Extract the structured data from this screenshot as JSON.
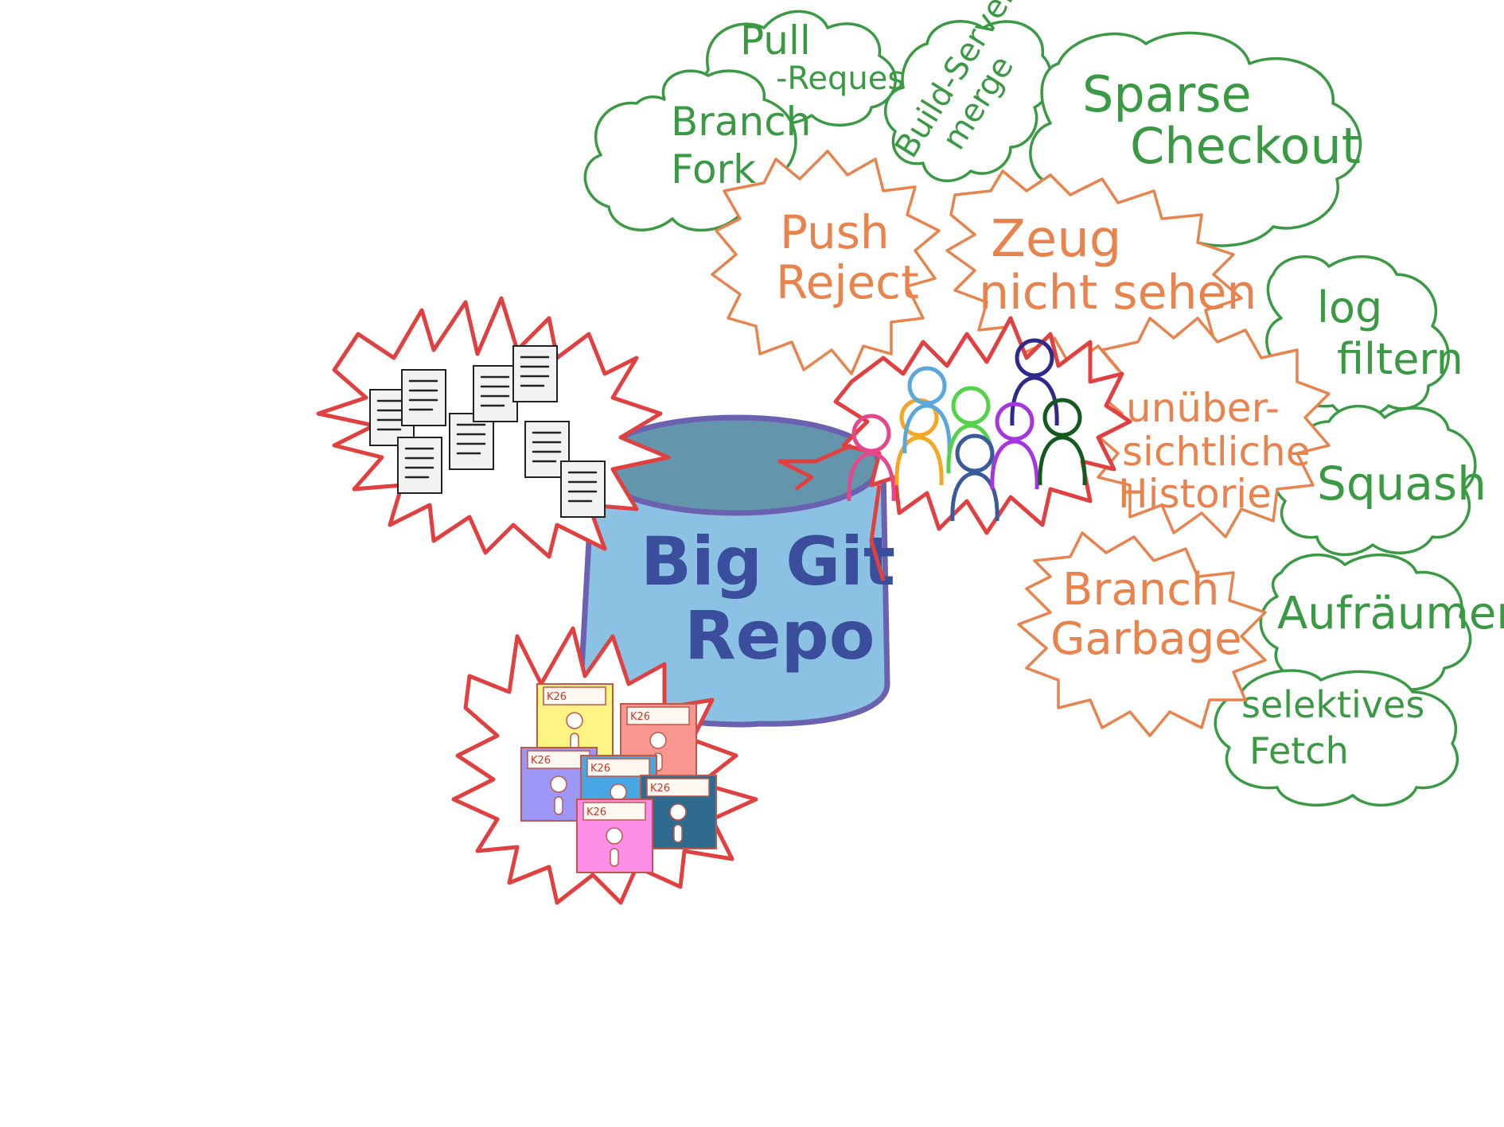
{
  "repo": {
    "line1": "Big Git",
    "line2": "Repo"
  },
  "colors": {
    "repo_fill": "#8bc1e3",
    "repo_top": "#6396ad",
    "repo_stroke": "#6a62b0",
    "green": "#3a9a44",
    "orange": "#e8834d",
    "red": "#e04040",
    "people": [
      "#e4478a",
      "#f5a623",
      "#5aa7dd",
      "#53d24a",
      "#3a5a9a",
      "#2f2a8a",
      "#a435e0",
      "#145a1e"
    ],
    "disks": [
      "#fdf484",
      "#f99690",
      "#9c97f7",
      "#47a6e4",
      "#2f6b8e",
      "#fc8ee8"
    ]
  },
  "clouds": {
    "pull_request": {
      "line1": "Pull",
      "line2": "-Request"
    },
    "branch_fork": {
      "line1": "Branch",
      "line2": "Fork"
    },
    "build_server": {
      "line1": "Build-Server",
      "line2": "merge"
    },
    "sparse_checkout": {
      "line1": "Sparse",
      "line2": "Checkout"
    },
    "log_filter": {
      "line1": "log",
      "line2": "filtern"
    },
    "squash": {
      "line1": "Squash"
    },
    "cleanup": {
      "line1": "Aufräumen"
    },
    "selective_fetch": {
      "line1": "selektives",
      "line2": "Fetch"
    }
  },
  "bursts": {
    "push_reject": {
      "line1": "Push",
      "line2": "Reject"
    },
    "not_seeing": {
      "line1": "Zeug",
      "line2": "nicht sehen"
    },
    "history": {
      "line1": "unüber-",
      "line2": "sichtliche",
      "line3": "Historie"
    },
    "branch_garbage": {
      "line1": "Branch",
      "line2": "Garbage"
    }
  },
  "icons": {
    "files": "many-documents-icon",
    "people": "people-group-icon",
    "disks": "floppy-disks-icon"
  },
  "disk_label": "K26"
}
